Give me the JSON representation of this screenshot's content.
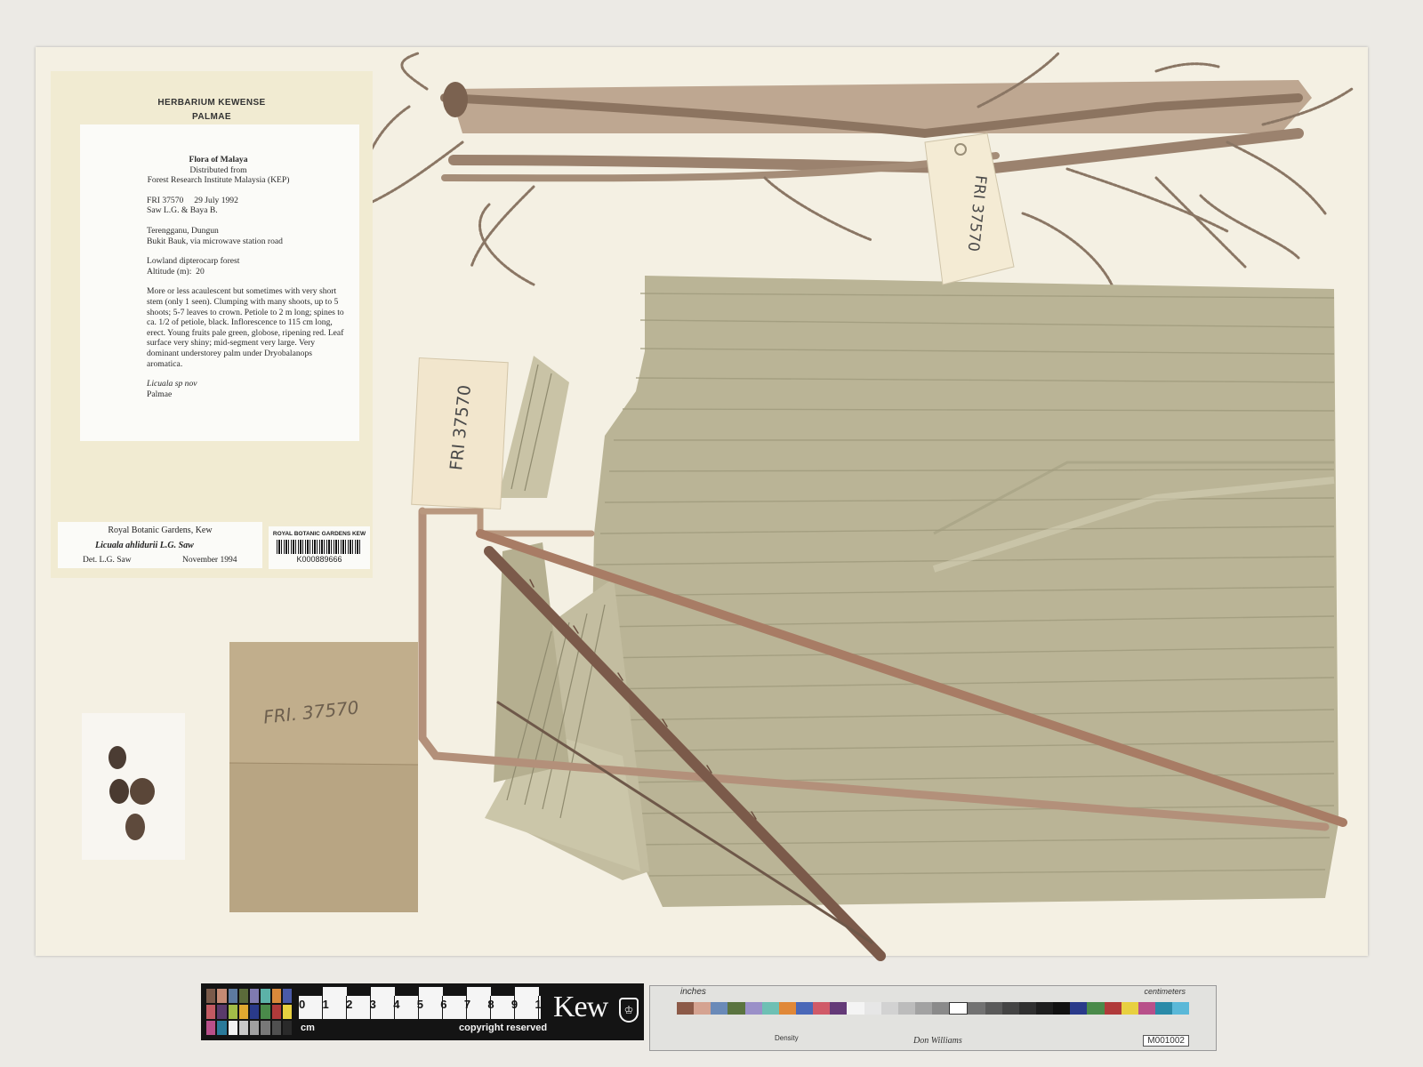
{
  "institution_header": {
    "line1": "HERBARIUM KEWENSE",
    "line2": "PALMAE"
  },
  "collection_label": {
    "title": "Flora of Malaya",
    "distributed": "Distributed from",
    "institute": "Forest Research Institute Malaysia (KEP)",
    "number_date": "FRI 37570     29 July 1992",
    "collectors": "Saw L.G. & Baya B.",
    "locality1": "Terengganu, Dungun",
    "locality2": "Bukit Bauk, via microwave station road",
    "habitat": "Lowland dipterocarp forest",
    "altitude": "Altitude (m):  20",
    "description": "More or less acaulescent but sometimes with very short stem (only 1 seen).  Clumping with many shoots, up to 5 shoots; 5-7 leaves to crown. Petiole to 2 m long; spines to ca. 1/2 of petiole, black.  Inflorescence to 115 cm long, erect. Young fruits pale green, globose, ripening red. Leaf surface very shiny; mid-segment very large. Very dominant understorey palm under Dryobalanops aromatica.",
    "name": "Licuala sp nov",
    "family": "Palmae"
  },
  "determination_label": {
    "institution": "Royal Botanic Gardens, Kew",
    "taxon": "Licuala ahlidurii L.G. Saw",
    "determiner": "Det. L.G. Saw",
    "date": "November 1994"
  },
  "barcode_label": {
    "heading": "ROYAL BOTANIC GARDENS KEW",
    "barcode": "K000889666"
  },
  "tags": {
    "top_tag": "FRI 37570",
    "middle_tag": "FRI 37570",
    "envelope": "FRI. 37570"
  },
  "scale_bar": {
    "numbers": [
      "0",
      "1",
      "2",
      "3",
      "4",
      "5",
      "6",
      "7",
      "8",
      "9",
      "10"
    ],
    "unit": "cm",
    "copyright": "copyright reserved",
    "logo": "Kew"
  },
  "color_target": {
    "inches_label": "inches",
    "cm_label": "centimeters",
    "density_label": "Density",
    "signature": "Don Williams",
    "code": "M001002"
  },
  "colors": {
    "sheet": "#f4f0e3",
    "leaf": "#b9b394",
    "stem": "#b58f72",
    "envelope": "#b6a17f"
  }
}
